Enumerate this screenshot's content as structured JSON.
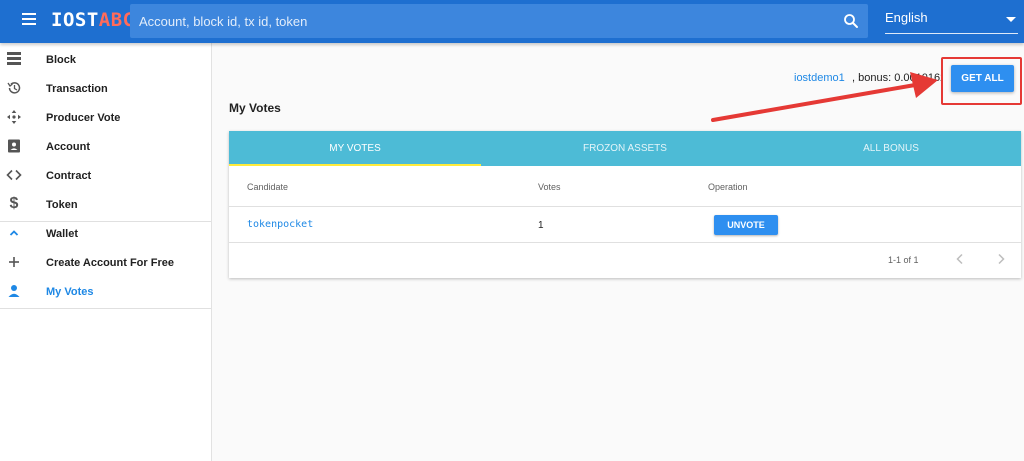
{
  "header": {
    "logo_part1": "IOST",
    "logo_part2": "ABC",
    "search_placeholder": "Account, block id, tx id, token",
    "language": "English",
    "accent_color": "#1e6fd0"
  },
  "sidebar": {
    "items": [
      {
        "label": "Block",
        "icon": "block-list-icon"
      },
      {
        "label": "Transaction",
        "icon": "history-icon"
      },
      {
        "label": "Producer Vote",
        "icon": "move-arrows-icon"
      },
      {
        "label": "Account",
        "icon": "account-card-icon"
      },
      {
        "label": "Contract",
        "icon": "code-brackets-icon"
      },
      {
        "label": "Token",
        "icon": "dollar-icon"
      },
      {
        "label": "Wallet",
        "icon": "chevron-up-icon"
      },
      {
        "label": "Create Account For Free",
        "icon": "plus-icon"
      },
      {
        "label": "My Votes",
        "icon": "person-icon",
        "active": true
      }
    ]
  },
  "main": {
    "account_name": "iostdemo1",
    "bonus_text": ", bonus: 0.00101627",
    "get_all_label": "GET ALL",
    "page_title": "My Votes",
    "tabs": [
      {
        "label": "MY VOTES",
        "active": true
      },
      {
        "label": "FROZON ASSETS"
      },
      {
        "label": "ALL BONUS"
      }
    ],
    "table": {
      "headers": [
        "Candidate",
        "Votes",
        "Operation"
      ],
      "rows": [
        {
          "candidate": "tokenpocket",
          "votes": "1",
          "action": "UNVOTE"
        }
      ]
    },
    "pagination": "1-1 of 1"
  },
  "annotation": {
    "highlight_color": "#e53935"
  }
}
